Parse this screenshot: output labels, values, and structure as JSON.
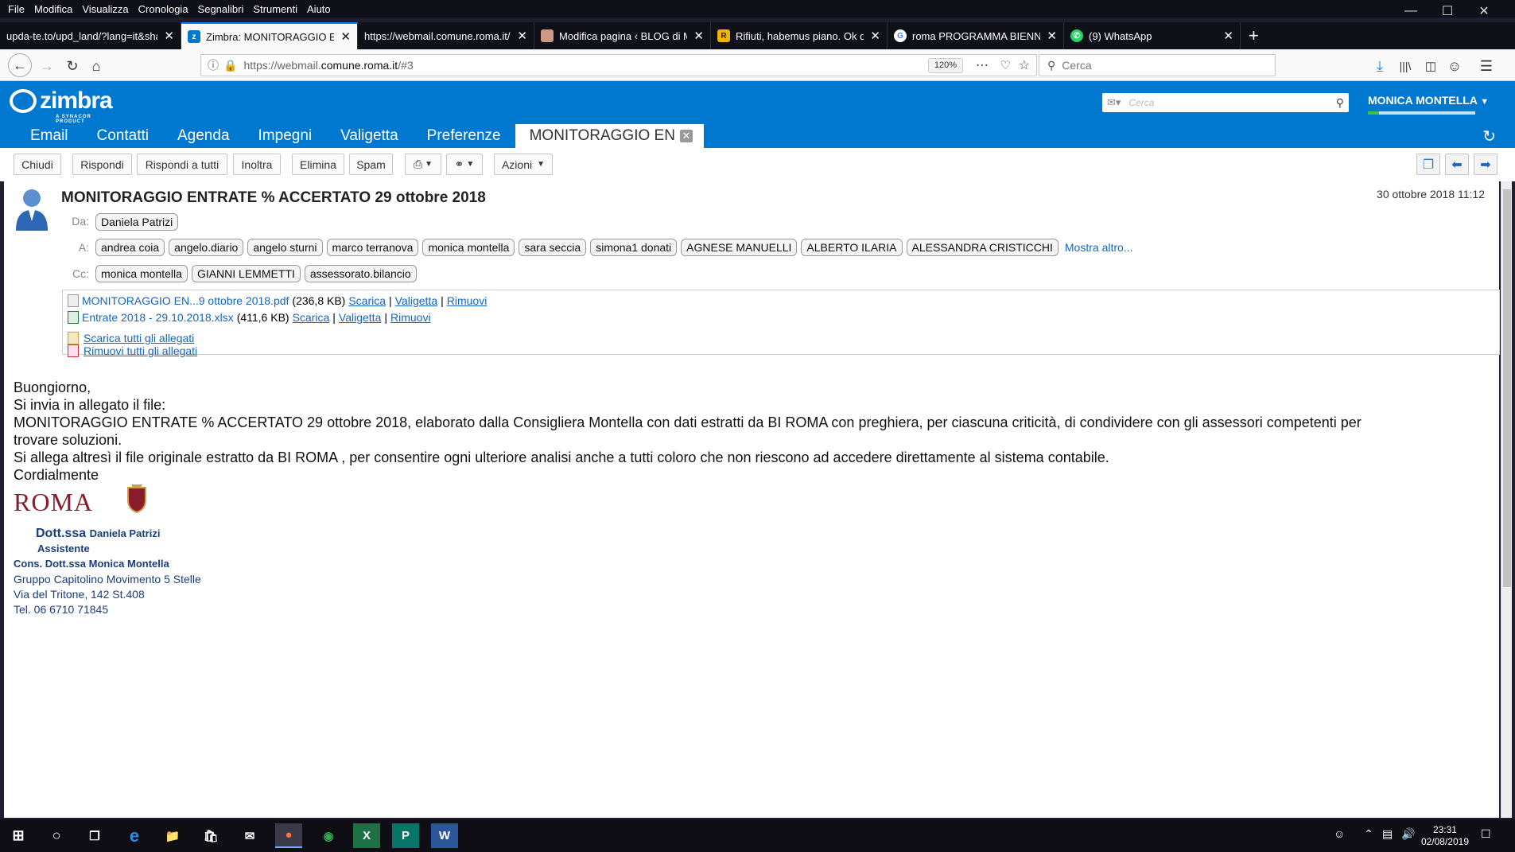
{
  "menubar": {
    "items": [
      "File",
      "Modifica",
      "Visualizza",
      "Cronologia",
      "Segnalibri",
      "Strumenti",
      "Aiuto"
    ]
  },
  "tabs": [
    {
      "title": "upda-te.to/upd_land/?lang=it&sha",
      "icon": "page-icon"
    },
    {
      "title": "Zimbra: MONITORAGGIO ENTRATE",
      "icon": "zimbra-icon"
    },
    {
      "title": "https://webmail.comune.roma.it/servi",
      "icon": "none"
    },
    {
      "title": "Modifica pagina ‹ BLOG di Monica",
      "icon": "avatar-icon"
    },
    {
      "title": "Rifiuti, habemus piano. Ok dalla",
      "icon": "news-icon"
    },
    {
      "title": "roma PROGRAMMA BIENNALE",
      "icon": "google-icon"
    },
    {
      "title": "(9) WhatsApp",
      "icon": "whatsapp-icon"
    }
  ],
  "navbar": {
    "url_prefix": "https://webmail.",
    "url_domain": "comune.roma.it",
    "url_suffix": "/#3",
    "zoom": "120%",
    "search_placeholder": "Cerca"
  },
  "zimbra": {
    "logo_text": "zimbra",
    "logo_sub": "A SYNACOR PRODUCT",
    "search_placeholder": "Cerca",
    "user": "MONICA MONTELLA",
    "app_tabs": [
      "Email",
      "Contatti",
      "Agenda",
      "Impegni",
      "Valigetta",
      "Preferenze"
    ],
    "active_tab": "MONITORAGGIO EN",
    "toolbar": {
      "close": "Chiudi",
      "reply": "Rispondi",
      "reply_all": "Rispondi a tutti",
      "forward": "Inoltra",
      "delete": "Elimina",
      "spam": "Spam",
      "actions": "Azioni"
    }
  },
  "message": {
    "subject": "MONITORAGGIO ENTRATE % ACCERTATO 29 ottobre 2018",
    "date": "30 ottobre 2018 11:12",
    "from_label": "Da:",
    "to_label": "A:",
    "cc_label": "Cc:",
    "from": [
      "Daniela Patrizi"
    ],
    "to": [
      "andrea coia",
      "angelo.diario",
      "angelo sturni",
      "marco terranova",
      "monica montella",
      "sara seccia",
      "simona1 donati",
      "AGNESE MANUELLI",
      "ALBERTO ILARIA",
      "ALESSANDRA CRISTICCHI"
    ],
    "show_more": "Mostra altro...",
    "cc": [
      "monica montella",
      "GIANNI LEMMETTI",
      "assessorato.bilancio"
    ],
    "attachments": [
      {
        "name": "MONITORAGGIO EN...9 ottobre 2018.pdf",
        "size": "(236,8 KB)"
      },
      {
        "name": "Entrate 2018 - 29.10.2018.xlsx",
        "size": "(411,6 KB)"
      }
    ],
    "att_actions": {
      "download": "Scarica",
      "briefcase": "Valigetta",
      "remove": "Rimuovi"
    },
    "download_all": "Scarica tutti gli allegati",
    "remove_all": "Rimuovi tutti gli allegati",
    "body": [
      "Buongiorno,",
      "Si invia in allegato il file:",
      "MONITORAGGIO ENTRATE % ACCERTATO 29 ottobre 2018, elaborato dalla Consigliera Montella con dati estratti da BI ROMA  con preghiera, per ciascuna criticità, di condividere con gli assessori competenti per",
      "trovare soluzioni.",
      "Si allega altresì il file originale estratto da BI ROMA , per consentire ogni ulteriore analisi anche a tutti coloro che non riescono ad accedere direttamente al sistema contabile.",
      "Cordialmente"
    ],
    "signature": {
      "logo_word": "ROMA",
      "title_prefix": "Dott.ssa",
      "name": "Daniela Patrizi",
      "role": "Assistente",
      "councillor": "Cons. Dott.ssa Monica Montella",
      "group": "Gruppo Capitolino Movimento 5 Stelle",
      "address": "Via del Tritone, 142 St.408",
      "phone": "Tel. 06 6710 71845"
    }
  },
  "taskbar": {
    "time": "23:31",
    "date": "02/08/2019"
  },
  "colors": {
    "zimbra_blue": "#0078d0",
    "link_blue": "#1566c0",
    "roma_red": "#8a1c2b",
    "signature_blue": "#1a3d7a"
  }
}
